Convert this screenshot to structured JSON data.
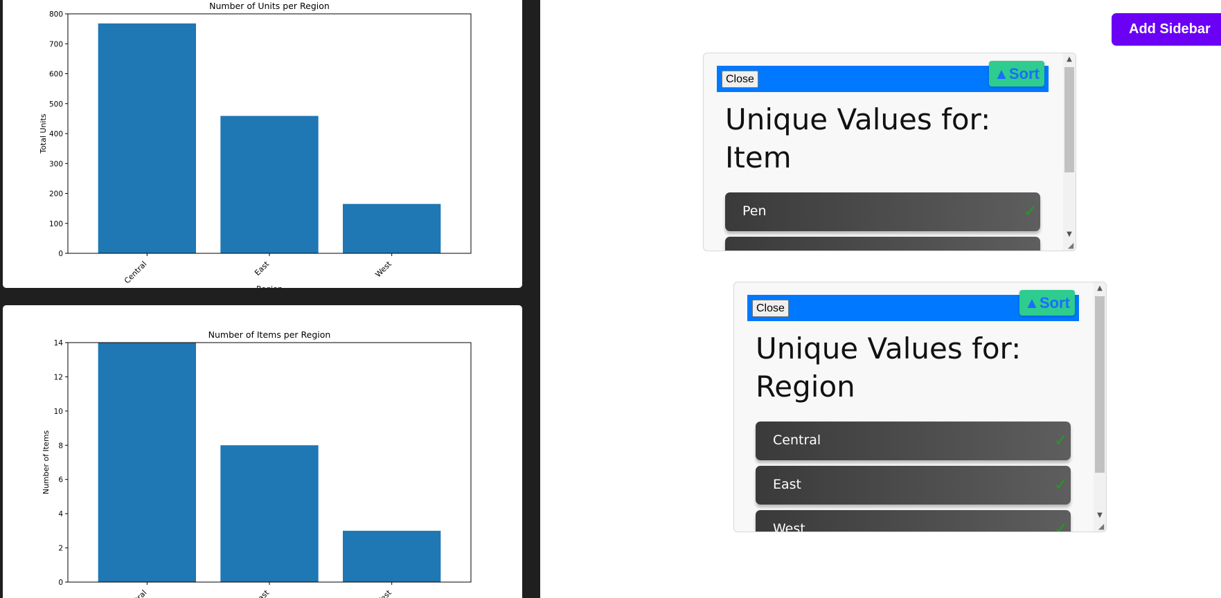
{
  "charts": [
    {
      "chart_data": {
        "type": "bar",
        "title": "Number of Units per Region",
        "xlabel": "Region",
        "ylabel": "Total Units",
        "categories": [
          "Central",
          "East",
          "West"
        ],
        "values": [
          768,
          459,
          165
        ],
        "ylim": [
          0,
          800
        ],
        "yticks": [
          0,
          100,
          200,
          300,
          400,
          500,
          600,
          700,
          800
        ],
        "color": "#1f77b4",
        "grid": false
      }
    },
    {
      "chart_data": {
        "type": "bar",
        "title": "Number of Items per Region",
        "xlabel": "",
        "ylabel": "Number of Items",
        "categories": [
          "Central",
          "East",
          "West"
        ],
        "values": [
          14,
          8,
          3
        ],
        "ylim": [
          0,
          14
        ],
        "yticks": [
          0,
          2,
          4,
          6,
          8,
          10,
          12,
          14
        ],
        "color": "#1f77b4",
        "grid": false
      }
    }
  ],
  "add_sidebar_label": "Add Sidebar",
  "popups": {
    "item": {
      "close_label": "Close",
      "sort_label": "▲Sort",
      "title": "Unique Values for: Item",
      "values": [
        {
          "label": "Pen",
          "check": "✓"
        }
      ]
    },
    "region": {
      "close_label": "Close",
      "sort_label": "▲Sort",
      "title": "Unique Values for: Region",
      "values": [
        {
          "label": "Central",
          "check": "✓"
        },
        {
          "label": "East",
          "check": "✓"
        },
        {
          "label": "West",
          "check": "✓"
        }
      ]
    }
  },
  "colors": {
    "accent_purple": "#6a00f4",
    "header_blue": "#0078ff",
    "sort_green": "#2ecc8f",
    "bar_blue": "#1f77b4"
  }
}
